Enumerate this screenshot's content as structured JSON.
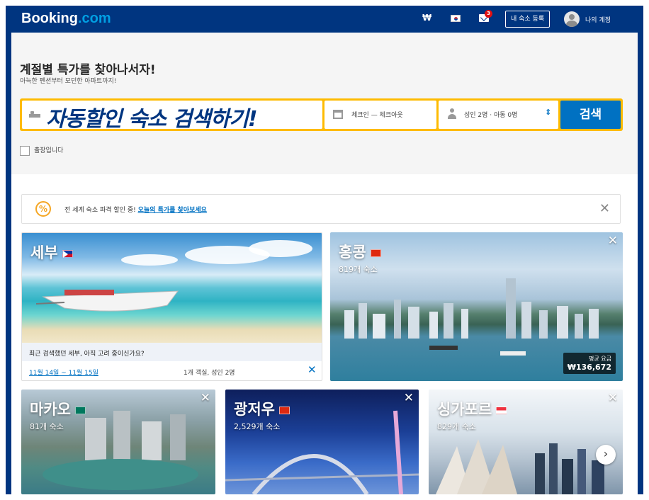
{
  "header": {
    "logo_main": "Booking",
    "logo_suffix": ".com",
    "currency": "₩",
    "notification_count": "3",
    "list_property": "내 숙소 등록",
    "account": "나의 계정"
  },
  "search": {
    "headline": "계절별 특가를 찾아나서자!",
    "subline": "아늑한 펜션부터 모던한 아파트까지!",
    "destination_value": "자동할인 숙소 검색하기!",
    "dates_text": "체크인 — 체크아웃",
    "guests_text": "성인 2명 · 아동 0명",
    "search_button": "검색",
    "business_label": "출장입니다"
  },
  "banner": {
    "text": "전 세계 숙소 파격 할인 중!",
    "link": "오늘의 특가를 찾아보세요"
  },
  "destinations": {
    "cebu": {
      "title": "세부",
      "question": "최근 검색했던 세부, 아직 고려 중이신가요?",
      "dates": "11월 14일 ~ 11월 15일",
      "guests": "1개 객실, 성인 2명"
    },
    "hongkong": {
      "title": "홍콩",
      "count": "819개 숙소",
      "price_label": "평균 요금",
      "price": "₩136,672"
    },
    "macau": {
      "title": "마카오",
      "count": "81개 숙소"
    },
    "guangzhou": {
      "title": "광저우",
      "count": "2,529개 숙소"
    },
    "singapore": {
      "title": "싱가포르",
      "count": "829개 숙소"
    }
  },
  "colors": {
    "brand_navy": "#003580",
    "accent_blue": "#0071c2",
    "search_yellow": "#febb02"
  }
}
